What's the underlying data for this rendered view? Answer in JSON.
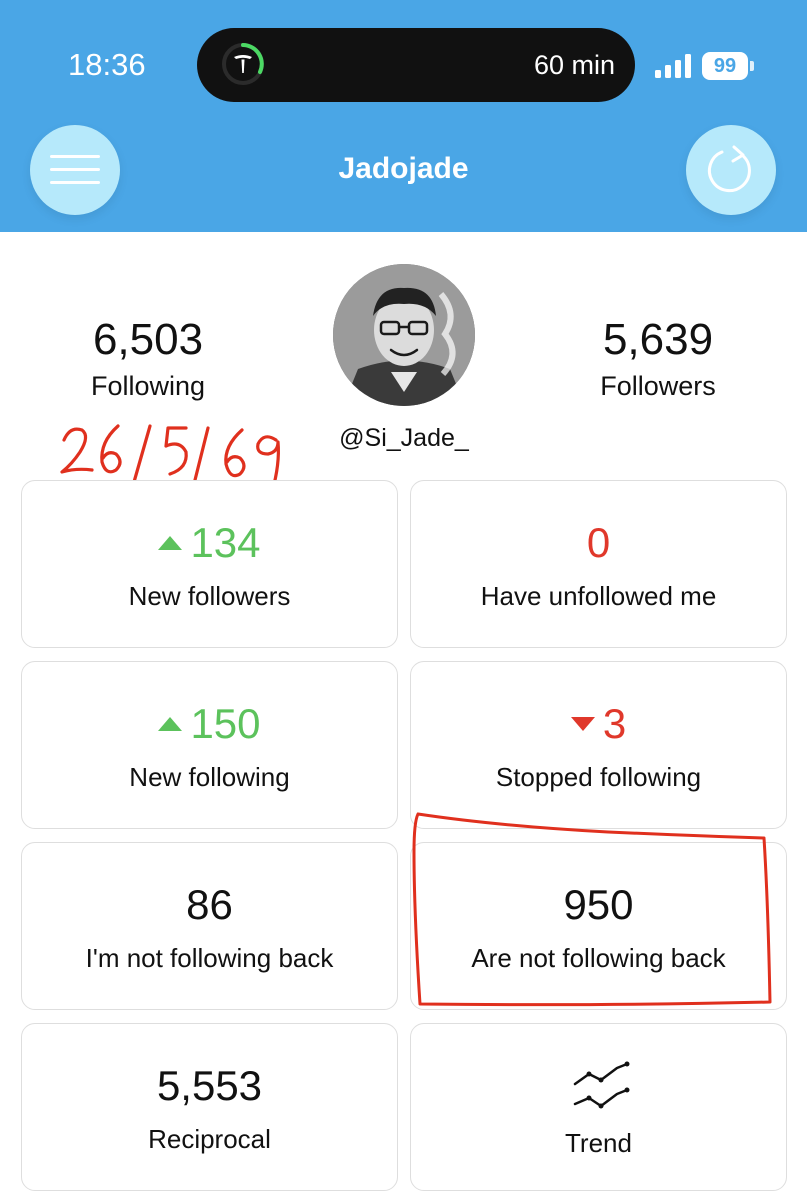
{
  "status_bar": {
    "time": "18:36",
    "live_activity_text": "60 min",
    "battery_level": "99",
    "live_activity_progress": 0.3
  },
  "header": {
    "title": "Jadojade",
    "menu_icon": "hamburger-menu-icon",
    "refresh_icon": "refresh-icon"
  },
  "profile": {
    "username": "@Si_Jade_",
    "following_count": "6,503",
    "following_label": "Following",
    "followers_count": "5,639",
    "followers_label": "Followers"
  },
  "annotation": {
    "handwritten_date": "26/5/69"
  },
  "cards": {
    "new_followers": {
      "value": "134",
      "label": "New followers",
      "direction": "up"
    },
    "have_unfollowed": {
      "value": "0",
      "label": "Have unfollowed me"
    },
    "new_following": {
      "value": "150",
      "label": "New following",
      "direction": "up"
    },
    "stopped_following": {
      "value": "3",
      "label": "Stopped following",
      "direction": "down"
    },
    "not_following_back": {
      "value": "86",
      "label": "I'm not following back"
    },
    "are_not_following_back": {
      "value": "950",
      "label": "Are not following back"
    },
    "reciprocal": {
      "value": "5,553",
      "label": "Reciprocal"
    },
    "trend": {
      "label": "Trend",
      "icon": "trend-chart-icon"
    }
  },
  "colors": {
    "header_bg": "#4aa6e6",
    "button_bg": "#b6e9fb",
    "increase": "#5cc25c",
    "decrease": "#e0382b",
    "annotation": "#e0301e"
  }
}
